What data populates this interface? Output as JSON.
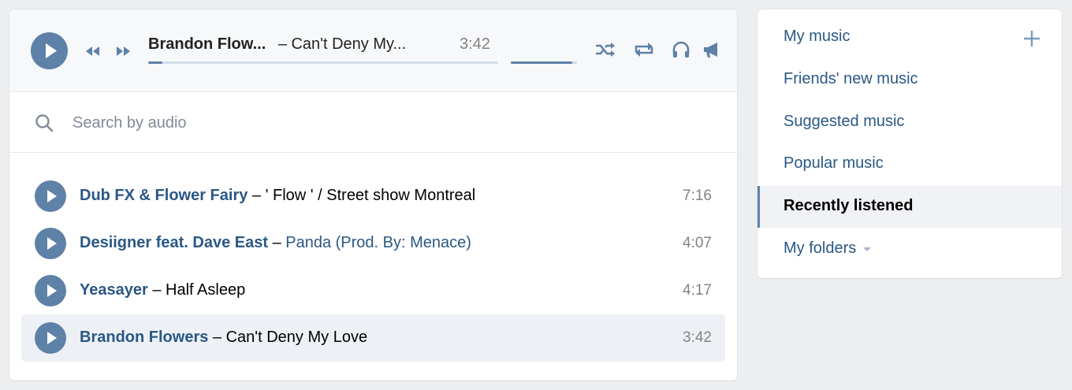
{
  "player": {
    "now_playing_artist": "Brandon Flow...",
    "now_playing_title": "– Can't Deny My...",
    "time": "3:42",
    "progress_fraction": 0.04,
    "volume_fraction": 0.93,
    "icons": {
      "play": "play-icon",
      "prev": "rewind-icon",
      "next": "fast-forward-icon",
      "shuffle": "shuffle-icon",
      "repeat": "repeat-icon",
      "headphones": "headphones-icon",
      "broadcast": "megaphone-icon"
    }
  },
  "search": {
    "placeholder": "Search by audio"
  },
  "tracks": [
    {
      "artist": "Dub FX & Flower Fairy",
      "sep": "–",
      "title": "' Flow ' / Street show Montreal",
      "title_is_link": false,
      "duration": "7:16",
      "active": false
    },
    {
      "artist": "Desiigner feat. Dave East",
      "sep": "–",
      "title": "Panda (Prod. By: Menace)",
      "title_is_link": true,
      "duration": "4:07",
      "active": false
    },
    {
      "artist": "Yeasayer",
      "sep": "–",
      "title": "Half Asleep",
      "title_is_link": false,
      "duration": "4:17",
      "active": false
    },
    {
      "artist": "Brandon Flowers",
      "sep": "–",
      "title": "Can't Deny My Love",
      "title_is_link": false,
      "duration": "3:42",
      "active": true
    }
  ],
  "sidebar": {
    "items": [
      {
        "label": "My music"
      },
      {
        "label": "Friends' new music"
      },
      {
        "label": "Suggested music"
      },
      {
        "label": "Popular music"
      },
      {
        "label": "Recently listened",
        "selected": true
      },
      {
        "label": "My folders"
      }
    ],
    "add_icon": "plus-icon"
  },
  "colors": {
    "accent": "#5e81a8",
    "link": "#2a5885",
    "background": "#edeef0"
  }
}
